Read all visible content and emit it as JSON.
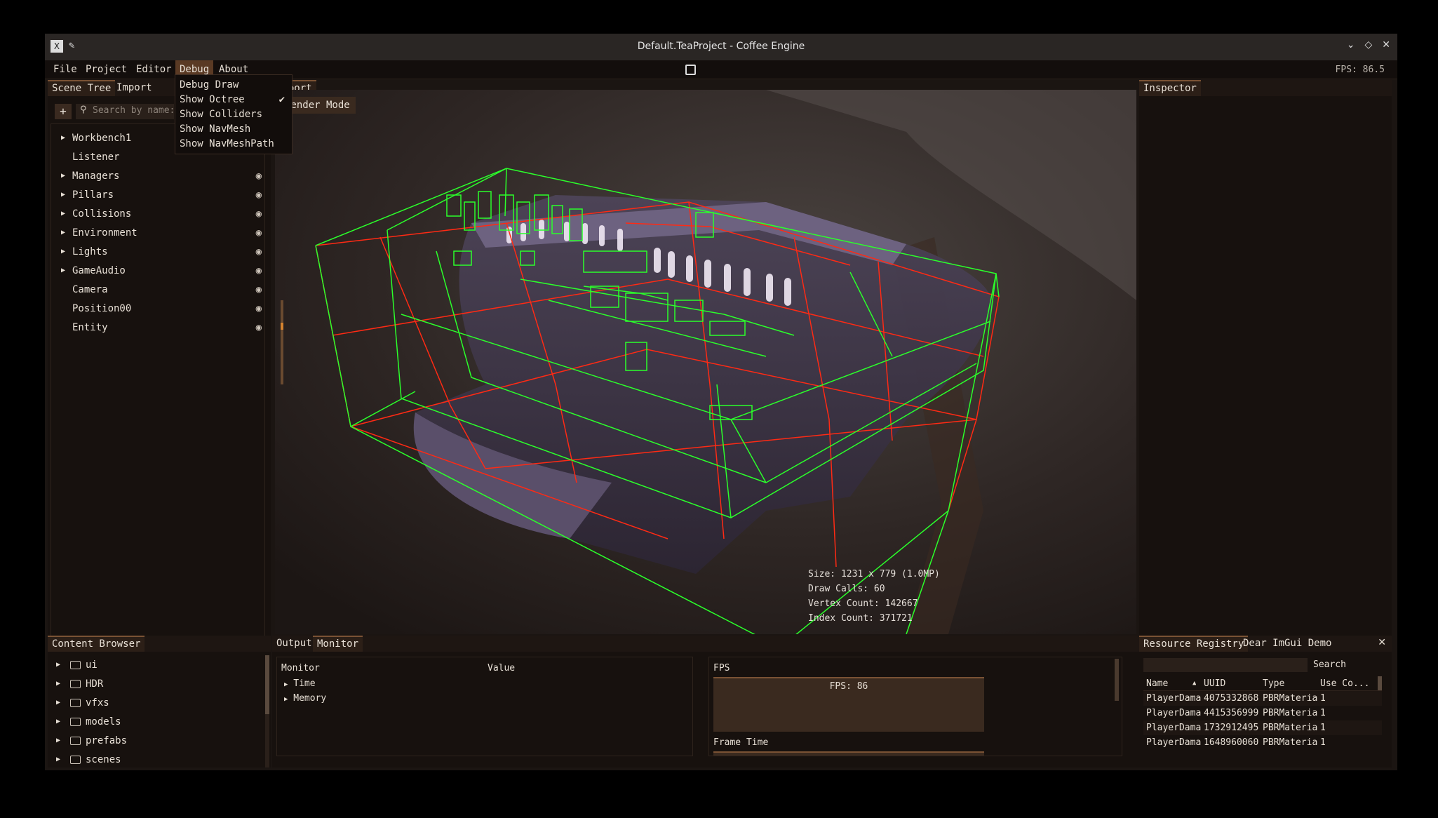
{
  "window": {
    "title": "Default.TeaProject - Coffee Engine"
  },
  "menubar": {
    "items": [
      "File",
      "Project",
      "Editor",
      "Debug",
      "About"
    ],
    "fps": "FPS: 86.5"
  },
  "debug_menu": {
    "items": [
      {
        "label": "Debug Draw",
        "checked": false
      },
      {
        "label": "Show Octree",
        "checked": true
      },
      {
        "label": "Show Colliders",
        "checked": false
      },
      {
        "label": "Show NavMesh",
        "checked": false
      },
      {
        "label": "Show NavMeshPath",
        "checked": false
      }
    ]
  },
  "scene_tree": {
    "tabs": [
      "Scene Tree",
      "Import"
    ],
    "search_placeholder": "Search by name:",
    "add_label": "+",
    "items": [
      {
        "label": "Workbench1",
        "expandable": true,
        "eye": false
      },
      {
        "label": "Listener",
        "expandable": false,
        "eye": false
      },
      {
        "label": "Managers",
        "expandable": true,
        "eye": true
      },
      {
        "label": "Pillars",
        "expandable": true,
        "eye": true
      },
      {
        "label": "Collisions",
        "expandable": true,
        "eye": true
      },
      {
        "label": "Environment",
        "expandable": true,
        "eye": true
      },
      {
        "label": "Lights",
        "expandable": true,
        "eye": true
      },
      {
        "label": "GameAudio",
        "expandable": true,
        "eye": true
      },
      {
        "label": "Camera",
        "expandable": false,
        "eye": true
      },
      {
        "label": "Position00",
        "expandable": false,
        "eye": true
      },
      {
        "label": "Entity",
        "expandable": false,
        "eye": true
      }
    ]
  },
  "viewport": {
    "tab": "ewport",
    "render_mode": "Render Mode",
    "stats": {
      "size": "Size: 1231 x 779 (1.0MP)",
      "draw_calls": "Draw Calls: 60",
      "vertex_count": "Vertex Count: 142667",
      "index_count": "Index Count: 371721"
    }
  },
  "inspector": {
    "tab": "Inspector"
  },
  "content_browser": {
    "tab": "Content Browser",
    "items": [
      "ui",
      "HDR",
      "vfxs",
      "models",
      "prefabs",
      "scenes"
    ]
  },
  "bottom": {
    "tabs": [
      "Output",
      "Monitor"
    ],
    "monitor": {
      "col_monitor": "Monitor",
      "col_value": "Value",
      "rows": [
        "Time",
        "Memory"
      ]
    },
    "fps_section": "FPS",
    "fps_graph_label": "FPS: 86",
    "frame_time_label": "Frame Time"
  },
  "resources": {
    "tabs": [
      "Resource Registry",
      "Dear ImGui Demo"
    ],
    "search_button": "Search",
    "columns": [
      "Name",
      "UUID",
      "Type",
      "Use Co..."
    ],
    "rows": [
      [
        "PlayerDama",
        "4075332868",
        "PBRMateria",
        "1"
      ],
      [
        "PlayerDama",
        "4415356999",
        "PBRMateria",
        "1"
      ],
      [
        "PlayerDama",
        "1732912495",
        "PBRMateria",
        "1"
      ],
      [
        "PlayerDama",
        "1648960060",
        "PBRMateria",
        "1"
      ]
    ]
  },
  "colors": {
    "accent": "#7a5234",
    "octree_green": "#2bff2b",
    "octree_red": "#ff2a14"
  }
}
